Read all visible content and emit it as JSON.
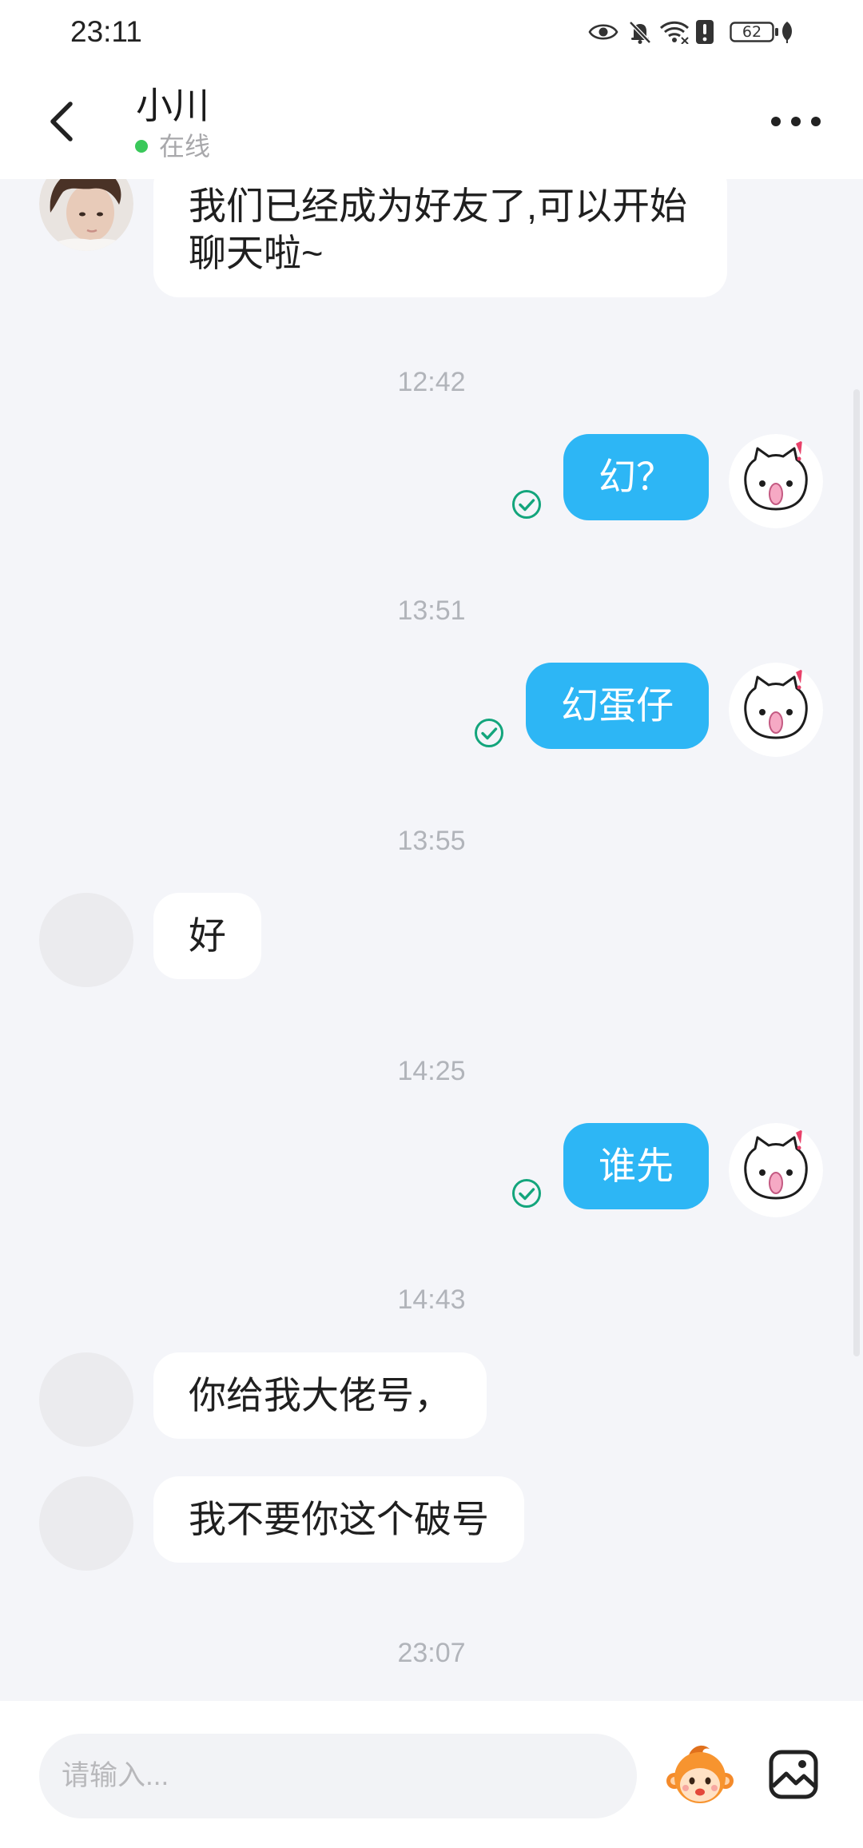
{
  "status_bar": {
    "time": "23:11",
    "battery_level": "62",
    "icons": [
      "eye-icon",
      "bell-muted-icon",
      "wifi-icon",
      "alert-icon",
      "battery-icon",
      "leaf-icon"
    ]
  },
  "header": {
    "contact_name": "小川",
    "presence": "在线",
    "back_icon": "chevron-left-icon",
    "menu_icon": "more-dots-icon"
  },
  "messages": [
    {
      "kind": "text",
      "sender": "friend",
      "text": "我们已经成为好友了,可以开始聊天啦~"
    },
    {
      "kind": "time",
      "text": "12:42"
    },
    {
      "kind": "text",
      "sender": "me",
      "text": "幻？",
      "status_icon": "check-circle-icon"
    },
    {
      "kind": "time",
      "text": "13:51"
    },
    {
      "kind": "text",
      "sender": "me",
      "text": "幻蛋仔",
      "status_icon": "check-circle-icon"
    },
    {
      "kind": "time",
      "text": "13:55"
    },
    {
      "kind": "text",
      "sender": "friend",
      "text": "好"
    },
    {
      "kind": "time",
      "text": "14:25"
    },
    {
      "kind": "text",
      "sender": "me",
      "text": "谁先",
      "status_icon": "check-circle-icon"
    },
    {
      "kind": "time",
      "text": "14:43"
    },
    {
      "kind": "text",
      "sender": "friend",
      "text": "你给我大佬号，"
    },
    {
      "kind": "text",
      "sender": "friend",
      "text": "我不要你这个破号"
    },
    {
      "kind": "time",
      "text": "23:07"
    }
  ],
  "composer": {
    "placeholder": "请输入...",
    "emoji_icon": "sticker-face-icon",
    "image_icon": "image-icon"
  },
  "colors": {
    "chat_background": "#f4f5f9",
    "outgoing_bubble": "#2db6f5",
    "incoming_bubble": "#ffffff",
    "read_check": "#13a57c",
    "presence_dot": "#3ac85a"
  }
}
